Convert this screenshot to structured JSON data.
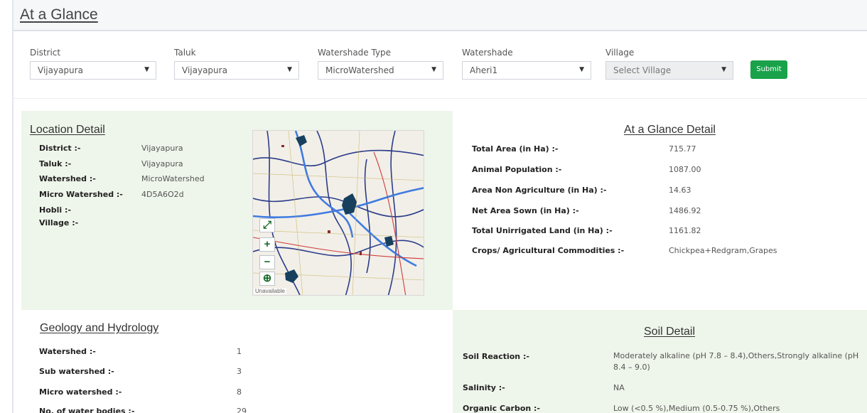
{
  "page": {
    "title": "At a Glance"
  },
  "filters": {
    "district": {
      "label": "District",
      "value": "Vijayapura"
    },
    "taluk": {
      "label": "Taluk",
      "value": "Vijayapura"
    },
    "watershade_type": {
      "label": "Watershade Type",
      "value": "MicroWatershed"
    },
    "watershade": {
      "label": "Watershade",
      "value": "Aheri1"
    },
    "village": {
      "label": "Village",
      "value": "Select Village"
    },
    "submit_label": "Submit",
    "caret": "▼"
  },
  "location_detail": {
    "title": "Location Detail",
    "rows": [
      {
        "key": "District :-",
        "value": "Vijayapura"
      },
      {
        "key": "Taluk :-",
        "value": "Vijayapura"
      },
      {
        "key": "Watershed :-",
        "value": "MicroWatershed"
      },
      {
        "key": "Micro Watershed :-",
        "value": "4D5A6O2d"
      },
      {
        "key": "Hobli :-",
        "value": ""
      },
      {
        "key": "Village :-",
        "value": ""
      }
    ]
  },
  "map": {
    "fullscreen_glyph": "⤢",
    "zoom_in": "+",
    "zoom_out": "−",
    "zoom_extent_glyph": "⊕",
    "unavailable_text": "Unavailable"
  },
  "glance_detail": {
    "title": "At a Glance Detail",
    "rows": [
      {
        "key": "Total Area (in Ha) :-",
        "value": "715.77"
      },
      {
        "key": "Animal Population :-",
        "value": "1087.00"
      },
      {
        "key": "Area Non Agriculture (in Ha) :-",
        "value": "14.63"
      },
      {
        "key": "Net Area Sown (in Ha) :-",
        "value": "1486.92"
      },
      {
        "key": "Total Unirrigated Land (in Ha) :-",
        "value": "1161.82"
      },
      {
        "key": "Crops/ Agricultural Commodities :-",
        "value": "Chickpea+Redgram,Grapes"
      }
    ]
  },
  "geology": {
    "title": "Geology and Hydrology",
    "rows": [
      {
        "key": "Watershed :-",
        "value": "1"
      },
      {
        "key": "Sub watershed :-",
        "value": "3"
      },
      {
        "key": "Micro watershed :-",
        "value": "8"
      },
      {
        "key": "No. of water bodies :-",
        "value": "29"
      }
    ]
  },
  "soil_detail": {
    "title": "Soil Detail",
    "rows": [
      {
        "key": "Soil Reaction :-",
        "value_line1": "Moderately alkaline (pH 7.8 – 8.4),Others,Strongly alkaline (pH",
        "value_line2": "8.4 – 9.0)"
      },
      {
        "key": "Salinity :-",
        "value_line1": "NA"
      },
      {
        "key": "Organic Carbon :-",
        "value_line1": "Low (<0.5 %),Medium (0.5-0.75 %),Others"
      }
    ]
  },
  "colors": {
    "accent_green": "#19a24a",
    "panel_green": "#eef5ea"
  }
}
